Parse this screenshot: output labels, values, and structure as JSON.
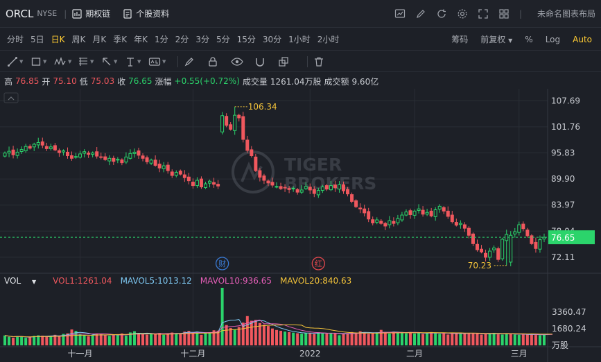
{
  "header": {
    "ticker": "ORCL",
    "exchange": "NYSE",
    "options_chain": "期权链",
    "stock_profile": "个股资料",
    "layout_label": "未命名图表布局"
  },
  "periods": {
    "items": [
      "分时",
      "5日",
      "日K",
      "周K",
      "月K",
      "季K",
      "年K",
      "1分",
      "2分",
      "3分",
      "5分",
      "15分",
      "30分",
      "1小时",
      "2小时"
    ],
    "active": "日K",
    "chips": "筹码",
    "adjust": "前复权",
    "percent": "%",
    "log": "Log",
    "auto": "Auto"
  },
  "quote": {
    "high_label": "高",
    "high": "76.85",
    "open_label": "开",
    "open": "75.10",
    "low_label": "低",
    "low": "75.03",
    "close_label": "收",
    "close": "76.65",
    "change_label": "涨幅",
    "change": "+0.55(+0.72%)",
    "volume_label": "成交量",
    "volume": "1261.04万股",
    "amount_label": "成交额",
    "amount": "9.60亿"
  },
  "volume_indicator": {
    "name": "VOL",
    "vol1": "VOL1:1261.04",
    "mavol5": "MAVOL5:1013.12",
    "mavol10": "MAVOL10:936.65",
    "mavol20": "MAVOL20:840.63"
  },
  "watermark": "TIGER BROKERS",
  "event_markers": [
    {
      "glyph": "财",
      "index": 52,
      "color": "#3a7bd5"
    },
    {
      "glyph": "红",
      "index": 75,
      "color": "#e5484d"
    }
  ],
  "colors": {
    "up": "#2bd46b",
    "down": "#f0585e",
    "price_tag": "#2bd46b",
    "accent": "#ffcc33"
  },
  "chart_data": {
    "type": "candlestick",
    "price_ticks": [
      "107.69",
      "101.76",
      "95.83",
      "89.90",
      "83.97",
      "78.04",
      "72.11"
    ],
    "price_range": [
      69.1,
      110.1
    ],
    "current_price": "76.65",
    "high_annotation": "106.34",
    "low_annotation": "70.23",
    "volume_ticks": [
      "3360.47",
      "1680.24"
    ],
    "volume_unit": "万股",
    "volume_max": 5800,
    "x_labels": [
      {
        "label": "十一月",
        "index": 18
      },
      {
        "label": "十二月",
        "index": 45
      },
      {
        "label": "2022",
        "index": 73
      },
      {
        "label": "二月",
        "index": 98
      },
      {
        "label": "三月",
        "index": 123
      }
    ],
    "closes": [
      95.8,
      96.2,
      95.4,
      96.0,
      96.6,
      97.3,
      96.9,
      97.8,
      98.2,
      97.6,
      96.8,
      97.2,
      96.5,
      95.9,
      96.3,
      95.2,
      94.6,
      95.0,
      95.6,
      96.1,
      95.5,
      95.8,
      95.1,
      94.8,
      94.3,
      94.6,
      93.9,
      94.4,
      93.6,
      94.9,
      95.7,
      96.0,
      95.3,
      94.6,
      93.8,
      94.2,
      93.0,
      92.4,
      92.9,
      91.8,
      90.7,
      91.4,
      91.0,
      90.2,
      89.5,
      88.4,
      89.6,
      88.1,
      88.8,
      89.4,
      88.7,
      88.3,
      104.3,
      102.1,
      101.2,
      104.4,
      103.8,
      98.9,
      96.4,
      95.2,
      91.8,
      90.3,
      89.6,
      89.0,
      88.5,
      88.2,
      87.7,
      87.9,
      87.5,
      87.8,
      86.9,
      87.4,
      88.2,
      87.4,
      86.6,
      87.3,
      88.1,
      87.6,
      88.4,
      87.9,
      88.6,
      87.2,
      86.5,
      84.8,
      83.6,
      83.1,
      82.2,
      80.8,
      79.9,
      80.6,
      79.8,
      79.2,
      80.4,
      79.8,
      80.9,
      81.7,
      82.4,
      81.8,
      82.6,
      83.1,
      81.9,
      82.3,
      81.5,
      82.9,
      83.7,
      82.6,
      81.4,
      80.2,
      79.4,
      79.8,
      78.7,
      77.1,
      75.2,
      73.8,
      73.3,
      72.1,
      73.5,
      74.2,
      71.6,
      76.2,
      77.3,
      77.1,
      77.9,
      79.5,
      78.6,
      77.0,
      75.2,
      74.1,
      76.1,
      76.65
    ],
    "volumes": [
      1000,
      850,
      780,
      920,
      880,
      760,
      820,
      960,
      1010,
      980,
      870,
      940,
      1060,
      980,
      1150,
      1210,
      1600,
      1450,
      1110,
      1040,
      920,
      990,
      1190,
      1120,
      1010,
      960,
      1100,
      1080,
      1200,
      980,
      1300,
      1420,
      1220,
      1120,
      1080,
      1190,
      1160,
      1250,
      1060,
      1180,
      1290,
      1220,
      1240,
      1380,
      1460,
      1280,
      1390,
      1060,
      1250,
      1330,
      1520,
      1480,
      5800,
      2050,
      1750,
      1600,
      1850,
      2290,
      2950,
      2480,
      2560,
      2250,
      2080,
      1950,
      1700,
      1550,
      1470,
      1390,
      1330,
      1280,
      1220,
      1180,
      1240,
      1260,
      1150,
      1320,
      1210,
      1180,
      1260,
      1190,
      1020,
      1130,
      1210,
      1340,
      1280,
      1420,
      1290,
      1160,
      1230,
      1310,
      1560,
      1280,
      1180,
      1380,
      1270,
      1350,
      1210,
      1320,
      1190,
      1280,
      1150,
      1220,
      1340,
      1280,
      1160,
      1250,
      1090,
      1180,
      1210,
      1290,
      1150,
      1240,
      1180,
      1220,
      1080,
      1130,
      1170,
      1260,
      1110,
      1090,
      1220,
      1150,
      1090,
      1060,
      1100,
      1080,
      1130,
      1040,
      1020,
      1080,
      1190,
      1261.04
    ]
  }
}
